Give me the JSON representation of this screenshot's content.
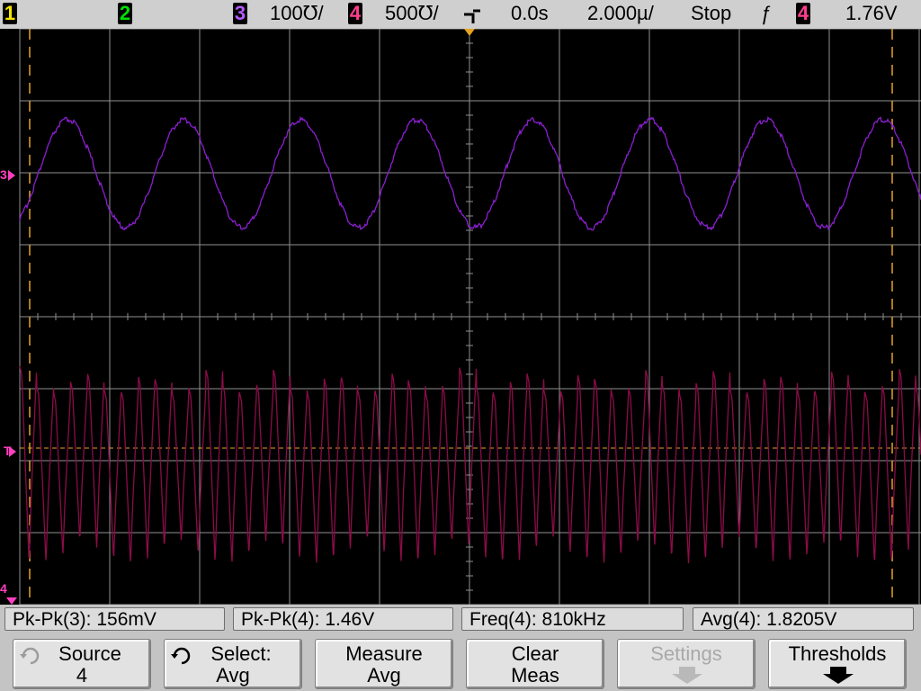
{
  "status": {
    "channels": [
      {
        "num": "1",
        "color": "#f4e400"
      },
      {
        "num": "2",
        "color": "#00e000"
      },
      {
        "num": "3",
        "color": "#b35cff"
      },
      {
        "num": "4",
        "color": "#ff3f8e"
      }
    ],
    "ch3_scale": "100℧/",
    "ch4_scale": "500℧/",
    "time_offset": "0.0s",
    "time_scale": "2.000µ/",
    "run_state": "Stop",
    "trigger_slope_symbol": "ƒ",
    "trigger_source": "4",
    "trigger_level": "1.76V"
  },
  "markers": {
    "ch3": "3",
    "trigger": "T",
    "ch4": "4"
  },
  "colors": {
    "ch3_trace": "#8b1fd1",
    "ch4_trace": "#8b0c48",
    "grid": "#8f8f8f",
    "cursor": "#e6a224",
    "marker_pink": "#ff3fbf"
  },
  "measurements": [
    {
      "label": "Pk-Pk(3): 156mV"
    },
    {
      "label": "Pk-Pk(4): 1.46V"
    },
    {
      "label": "Freq(4): 810kHz"
    },
    {
      "label": "Avg(4): 1.8205V"
    }
  ],
  "softkeys": [
    {
      "line1": "Source",
      "line2": "4",
      "icon": "rotate-knob-icon",
      "enabled": true
    },
    {
      "line1": "Select:",
      "line2": "Avg",
      "icon": "rotate-knob-icon",
      "enabled": true
    },
    {
      "line1": "Measure",
      "line2": "Avg",
      "enabled": true
    },
    {
      "line1": "Clear",
      "line2": "Meas",
      "enabled": true
    },
    {
      "line1": "Settings",
      "icon": "down-arrow-icon",
      "enabled": false
    },
    {
      "line1": "Thresholds",
      "icon": "down-arrow-icon",
      "enabled": true
    }
  ]
}
